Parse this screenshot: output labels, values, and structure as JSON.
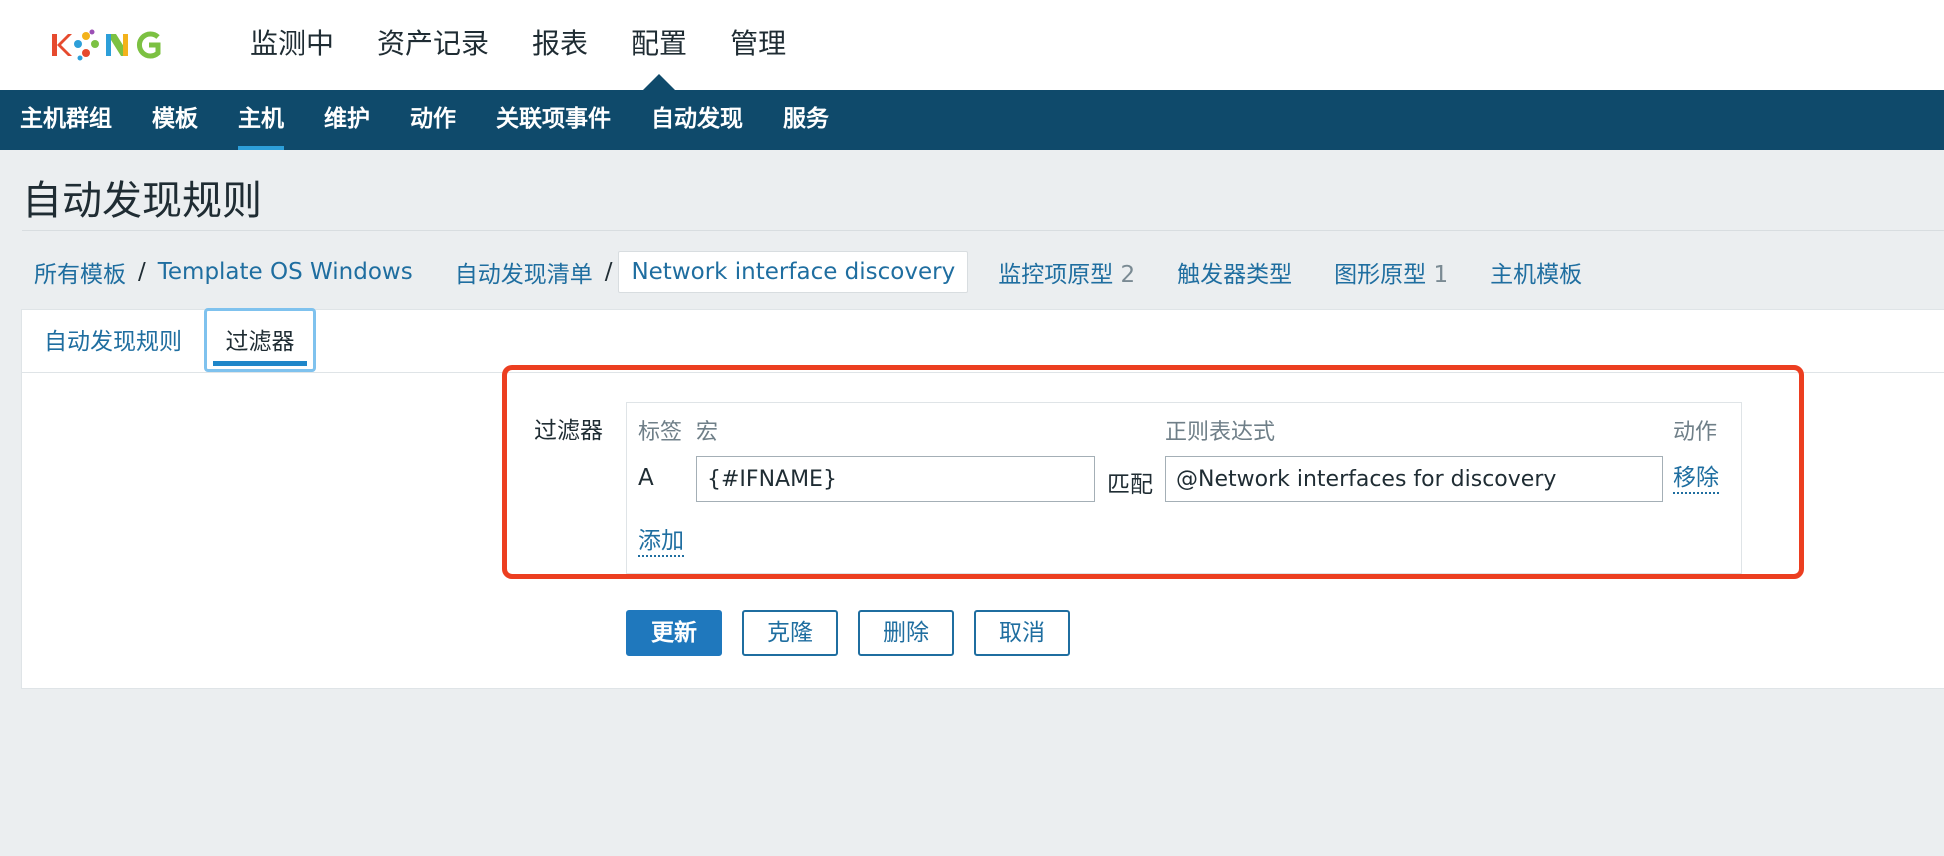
{
  "brand": {
    "logo_text": "KONG"
  },
  "top_menu": [
    {
      "label": "监测中"
    },
    {
      "label": "资产记录"
    },
    {
      "label": "报表"
    },
    {
      "label": "配置",
      "active": true
    },
    {
      "label": "管理"
    }
  ],
  "sub_menu": [
    {
      "label": "主机群组"
    },
    {
      "label": "模板"
    },
    {
      "label": "主机",
      "active": true
    },
    {
      "label": "维护"
    },
    {
      "label": "动作"
    },
    {
      "label": "关联项事件"
    },
    {
      "label": "自动发现"
    },
    {
      "label": "服务"
    }
  ],
  "page": {
    "title": "自动发现规则"
  },
  "breadcrumbs": {
    "all_templates": "所有模板",
    "sep": "/",
    "template": "Template OS Windows",
    "discovery_list": "自动发现清单",
    "current": "Network interface discovery",
    "item_prototypes": "监控项原型",
    "item_prototypes_count": "2",
    "trigger_types": "触发器类型",
    "graph_prototypes": "图形原型",
    "graph_prototypes_count": "1",
    "host_templates": "主机模板"
  },
  "tabs": [
    {
      "label": "自动发现规则"
    },
    {
      "label": "过滤器",
      "active": true
    }
  ],
  "filter": {
    "label": "过滤器",
    "headers": {
      "tag": "标签",
      "macro": "宏",
      "regex": "正则表达式",
      "action": "动作"
    },
    "rows": [
      {
        "tag": "A",
        "macro": "{#IFNAME}",
        "match": "匹配",
        "regex": "@Network interfaces for discovery",
        "remove": "移除"
      }
    ],
    "add": "添加"
  },
  "buttons": {
    "update": "更新",
    "clone": "克隆",
    "delete": "删除",
    "cancel": "取消"
  },
  "colors": {
    "nav": "#0f4a6b",
    "accent": "#1f78bd",
    "link": "#1f6ea0",
    "highlight": "#ec3e20"
  }
}
